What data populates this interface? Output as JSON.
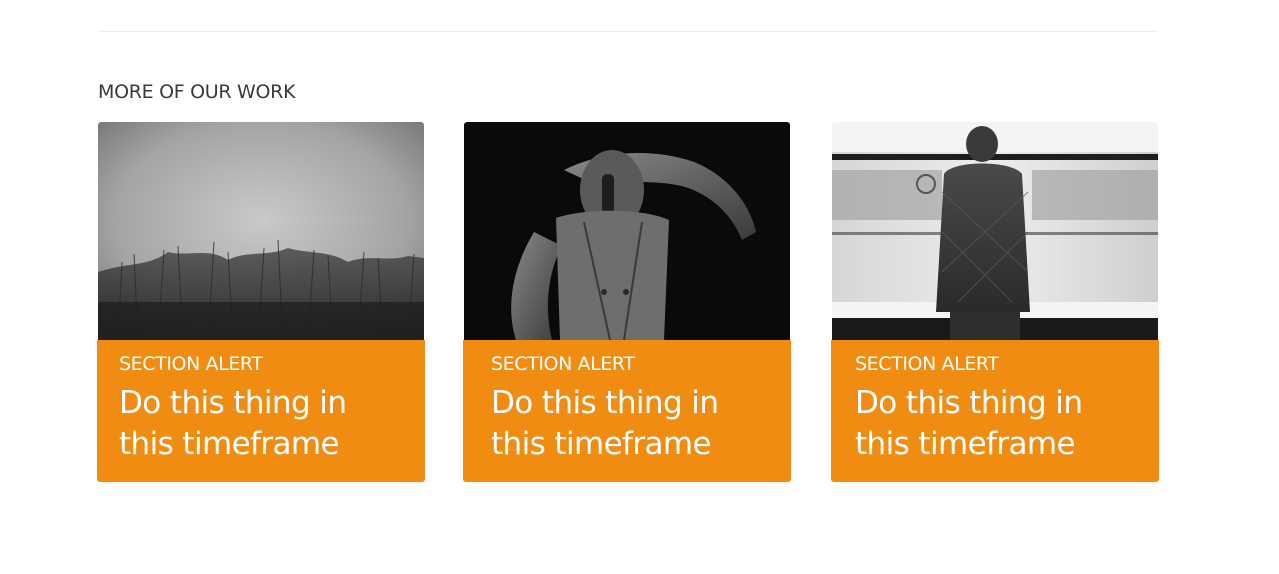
{
  "section": {
    "heading": "MORE OF OUR WORK"
  },
  "cards": [
    {
      "image_alt": "Black and white photo of tall grass under an overcast sky",
      "eyebrow": "SECTION ALERT",
      "title": "Do this thing in this timeframe"
    },
    {
      "image_alt": "Black and white photo of a performer covering his eyes while singing into a microphone",
      "eyebrow": "SECTION ALERT",
      "title": "Do this thing in this timeframe"
    },
    {
      "image_alt": "Black and white photo of a man in a quilted jacket facing a passing subway train",
      "eyebrow": "SECTION ALERT",
      "title": "Do this thing in this timeframe"
    }
  ],
  "colors": {
    "accent": "#f18c13",
    "heading_text": "#3a3a3a",
    "divider": "#ececec"
  }
}
